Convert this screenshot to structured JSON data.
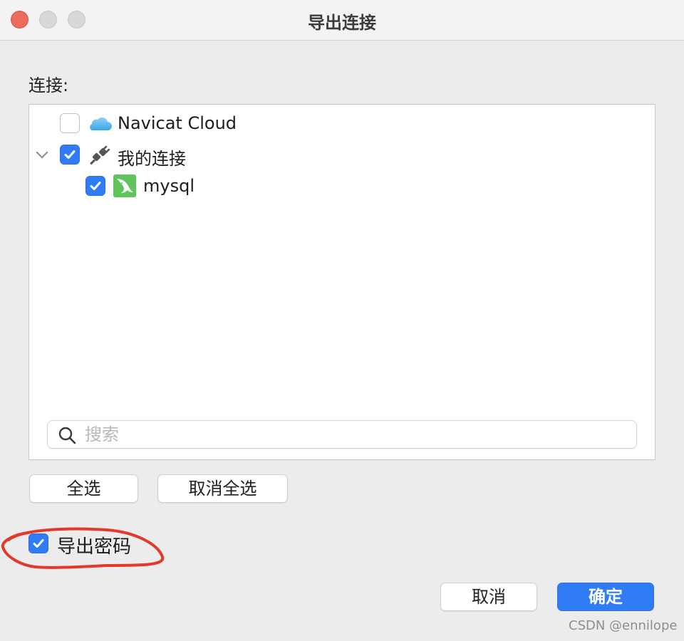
{
  "window": {
    "title": "导出连接",
    "controls": [
      "close",
      "minimize",
      "maximize"
    ]
  },
  "connections_label": "连接:",
  "tree": {
    "items": [
      {
        "label": "Navicat Cloud",
        "checked": false,
        "icon": "cloud-icon"
      },
      {
        "label": "我的连接",
        "checked": true,
        "expanded": true,
        "icon": "plug-icon"
      },
      {
        "label": "mysql",
        "checked": true,
        "icon": "mysql-dolphin-icon"
      }
    ]
  },
  "search": {
    "placeholder": "搜索",
    "value": ""
  },
  "buttons": {
    "select_all": "全选",
    "deselect_all": "取消全选",
    "cancel": "取消",
    "ok": "确定"
  },
  "export_password": {
    "label": "导出密码",
    "checked": true
  },
  "watermark": "CSDN @ennilope",
  "colors": {
    "accent": "#2f7cf6",
    "close": "#ed6a5e",
    "annotation": "#e2392a",
    "mysql_icon": "#5fc55a"
  }
}
